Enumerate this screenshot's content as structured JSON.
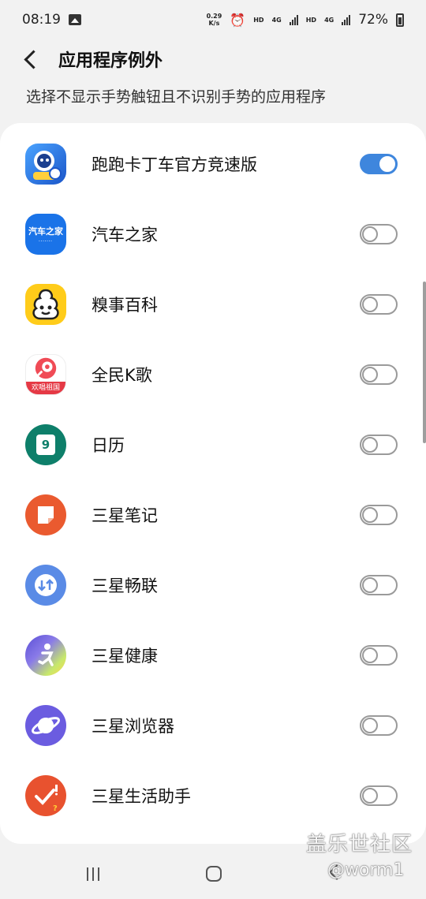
{
  "status_bar": {
    "time": "08:19",
    "net_speed_value": "0.29",
    "net_speed_unit": "K/s",
    "hd1": "HD",
    "g1": "4G",
    "hd2": "HD",
    "g2": "4G",
    "battery": "72%"
  },
  "header": {
    "title": "应用程序例外"
  },
  "description": "选择不显示手势触钮且不识别手势的应用程序",
  "apps": [
    {
      "name": "跑跑卡丁车官方竞速版",
      "enabled": true,
      "icon": "kart-rider-icon",
      "icon_text": "",
      "color": "#2a6fd6"
    },
    {
      "name": "汽车之家",
      "enabled": false,
      "icon": "autohome-icon",
      "icon_text": "汽车之家",
      "color": "#1a73e8"
    },
    {
      "name": "糗事百科",
      "enabled": false,
      "icon": "qiushibaike-icon",
      "icon_text": "",
      "color": "#ffcc1a"
    },
    {
      "name": "全民K歌",
      "enabled": false,
      "icon": "kge-icon",
      "icon_text": "欢唱祖国",
      "color": "#f04b56"
    },
    {
      "name": "日历",
      "enabled": false,
      "icon": "calendar-icon",
      "icon_text": "9",
      "color": "#0e7f6a"
    },
    {
      "name": "三星笔记",
      "enabled": false,
      "icon": "samsung-notes-icon",
      "icon_text": "",
      "color": "#ea5a2f"
    },
    {
      "name": "三星畅联",
      "enabled": false,
      "icon": "samsung-connect-icon",
      "icon_text": "",
      "color": "#5a8be6"
    },
    {
      "name": "三星健康",
      "enabled": false,
      "icon": "samsung-health-icon",
      "icon_text": "",
      "color": "#6a5bd8"
    },
    {
      "name": "三星浏览器",
      "enabled": false,
      "icon": "samsung-internet-icon",
      "icon_text": "",
      "color": "#6b5ce0"
    },
    {
      "name": "三星生活助手",
      "enabled": false,
      "icon": "samsung-reminder-icon",
      "icon_text": "",
      "color": "#e8522f"
    }
  ],
  "watermark": {
    "line1": "盖乐世社区",
    "line2": "@worm1"
  }
}
